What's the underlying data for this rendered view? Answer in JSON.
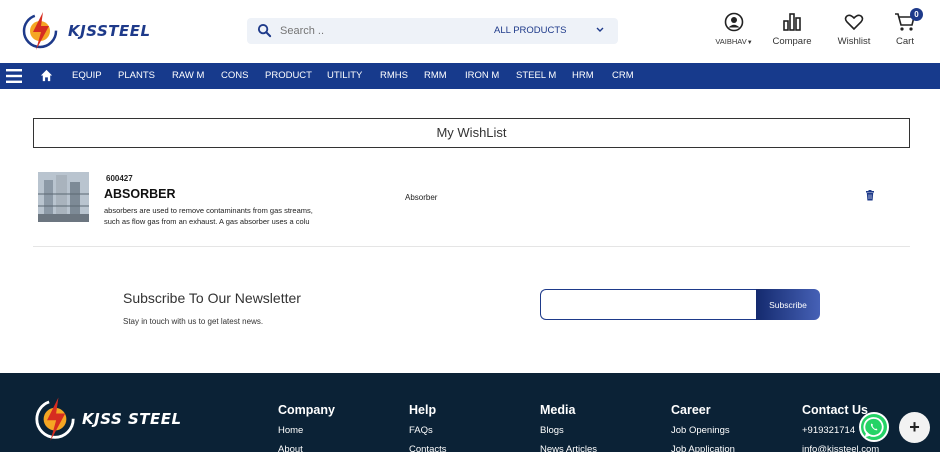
{
  "header": {
    "logo_text": "KJSSTEEL",
    "search": {
      "placeholder": "Search ..",
      "category": "ALL PRODUCTS"
    },
    "user_label": "VAIBHAV",
    "compare_label": "Compare",
    "wishlist_label": "Wishlist",
    "cart_label": "Cart",
    "cart_count": "0"
  },
  "nav": {
    "items": [
      "EQUIP",
      "PLANTS",
      "RAW M",
      "CONS",
      "PRODUCT",
      "UTILITY",
      "RMHS",
      "RMM",
      "IRON M",
      "STEEL M",
      "HRM",
      "CRM"
    ]
  },
  "wishlist": {
    "title": "My WishList",
    "items": [
      {
        "code": "600427",
        "name": "ABSORBER",
        "description_line1": "absorbers are used to remove contaminants from gas streams,",
        "description_line2": "such as flow gas from an exhaust. A gas absorber uses a colu",
        "category": "Absorber"
      }
    ]
  },
  "newsletter": {
    "title": "Subscribe To Our Newsletter",
    "subtitle": "Stay in touch with us to get latest news.",
    "button_label": "Subscribe",
    "email_value": ""
  },
  "footer": {
    "logo_text": "KJSS STEEL",
    "columns": [
      {
        "title": "Company",
        "links": [
          "Home",
          "About"
        ]
      },
      {
        "title": "Help",
        "links": [
          "FAQs",
          "Contacts"
        ]
      },
      {
        "title": "Media",
        "links": [
          "Blogs",
          "News Articles"
        ]
      },
      {
        "title": "Career",
        "links": [
          "Job Openings",
          "Job Application"
        ]
      },
      {
        "title": "Contact Us",
        "links": [
          "+919321714",
          "info@kjssteel.com"
        ]
      }
    ]
  },
  "colors": {
    "brand_blue": "#173a8c",
    "footer_bg": "#0b2236",
    "whatsapp": "#25d366"
  },
  "icons": [
    "search-icon",
    "chevron-down-icon",
    "user-icon",
    "compare-icon",
    "heart-icon",
    "cart-icon",
    "hamburger-icon",
    "home-icon",
    "trash-icon",
    "whatsapp-icon",
    "plus-icon"
  ]
}
